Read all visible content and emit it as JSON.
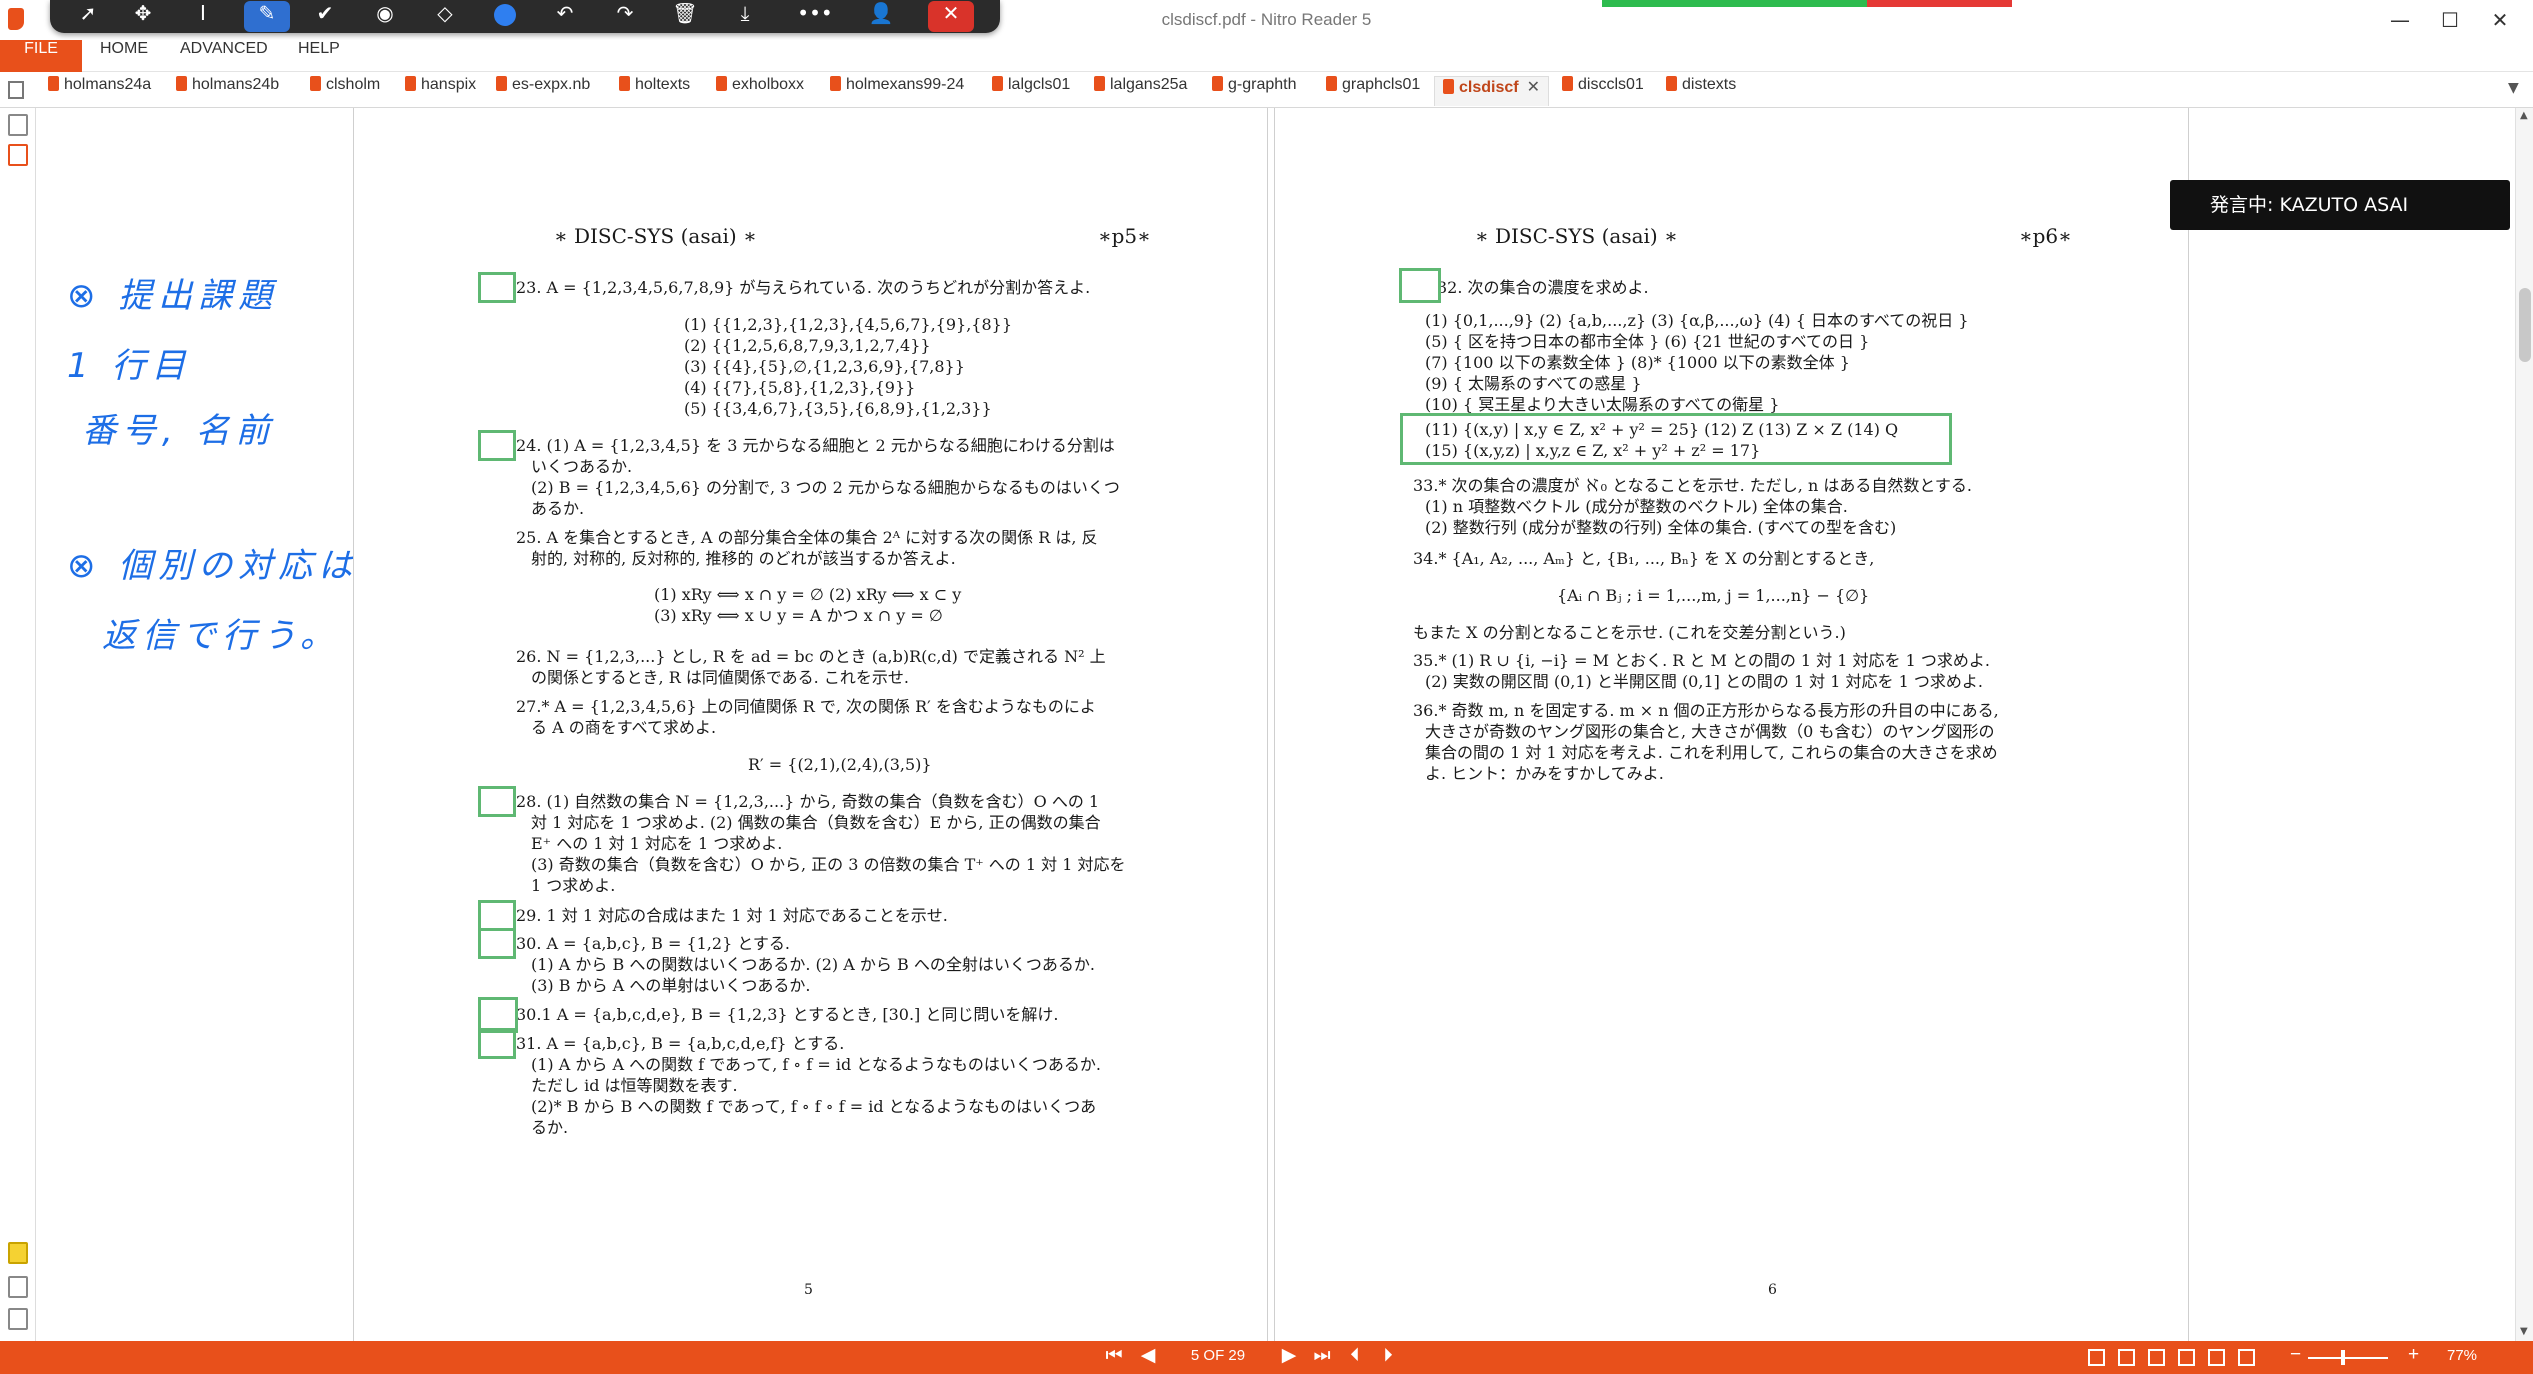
{
  "window": {
    "title": "clsdiscf.pdf - Nitro Reader 5",
    "minimize": "—",
    "maximize": "☐",
    "close": "✕"
  },
  "colors": {
    "accent": "#e8501b",
    "ink": "#1d6ee6",
    "box": "#5fb873",
    "share_green": "#2dbb4e",
    "share_red": "#e53935"
  },
  "annot_toolbar": {
    "icons": [
      "select-icon",
      "move-icon",
      "text-cursor-icon",
      "pen-icon",
      "check-icon",
      "highlighter-icon",
      "eraser-icon",
      "color-dot-icon",
      "undo-icon",
      "redo-icon",
      "trash-icon",
      "download-icon",
      "more-icon",
      "share-user-icon",
      "close-icon"
    ]
  },
  "ribbon": {
    "file": "FILE",
    "home": "HOME",
    "advanced": "ADVANCED",
    "help": "HELP"
  },
  "tabs": [
    "holmans24a",
    "holmans24b",
    "clsholm",
    "hanspix",
    "es-expx.nb",
    "holtexts",
    "exholboxx",
    "holmexans99-24",
    "lalgcls01",
    "lalgans25a",
    "g-graphth",
    "graphcls01",
    "clsdiscf",
    "disccls01",
    "distexts"
  ],
  "active_tab": "clsdiscf",
  "tab_close": "✕",
  "speaking": "発言中: KAZUTO ASAI",
  "ink_notes": {
    "line1": "⊗ 提出課題",
    "line2": "1 行目",
    "line3": "番号, 名前",
    "line4": "⊗ 個別の対応は",
    "line5": "返信で行う。"
  },
  "page5": {
    "header_left": "∗ DISC-SYS (asai) ∗",
    "header_right": "∗p5∗",
    "lines": [
      "23. A = {1,2,3,4,5,6,7,8,9} が与えられている. 次のうちどれが分割か答えよ.",
      "(1) {{1,2,3},{1,2,3},{4,5,6,7},{9},{8}}",
      "(2) {{1,2,5,6,8,7,9,3,1,2,7,4}}",
      "(3) {{4},{5},∅,{1,2,3,6,9},{7,8}}",
      "(4) {{7},{5,8},{1,2,3},{9}}",
      "(5) {{3,4,6,7},{3,5},{6,8,9},{1,2,3}}",
      "24. (1) A = {1,2,3,4,5} を 3 元からなる細胞と 2 元からなる細胞にわける分割は",
      "いくつあるか.",
      "(2) B = {1,2,3,4,5,6} の分割で, 3 つの 2 元からなる細胞からなるものはいくつ",
      "あるか.",
      "25. A を集合とするとき, A の部分集合全体の集合 2ᴬ に対する次の関係 R は, 反",
      "射的, 対称的, 反対称的, 推移的 のどれが該当するか答えよ.",
      "(1) xRy ⟺ x ∩ y = ∅      (2) xRy ⟺ x ⊂ y",
      "(3) xRy ⟺ x ∪ y = A かつ x ∩ y = ∅",
      "26. N = {1,2,3,...} とし, R を ad = bc のとき (a,b)R(c,d) で定義される N² 上",
      "の関係とするとき, R は同値関係である. これを示せ.",
      "27.* A = {1,2,3,4,5,6} 上の同値関係 R で, 次の関係 R′ を含むようなものによ",
      "る A の商をすべて求めよ.",
      "R′ = {(2,1),(2,4),(3,5)}",
      "28. (1) 自然数の集合 N = {1,2,3,...} から, 奇数の集合（負数を含む）O への 1",
      "対 1 対応を 1 つ求めよ. (2) 偶数の集合（負数を含む）E から, 正の偶数の集合",
      "E⁺ への 1 対 1 対応を 1 つ求めよ.",
      "(3) 奇数の集合（負数を含む）O から, 正の 3 の倍数の集合 T⁺ への 1 対 1 対応を",
      "1 つ求めよ.",
      "29. 1 対 1 対応の合成はまた 1 対 1 対応であることを示せ.",
      "30. A = {a,b,c}, B = {1,2} とする.",
      "(1) A から B への関数はいくつあるか. (2) A から B への全射はいくつあるか.",
      "(3) B から A への単射はいくつあるか.",
      "30.1 A = {a,b,c,d,e}, B = {1,2,3} とするとき, [30.] と同じ問いを解け.",
      "31. A = {a,b,c}, B = {a,b,c,d,e,f} とする.",
      "(1) A から A への関数 f であって, f ∘ f = id となるようなものはいくつあるか.",
      "ただし id は恒等関数を表す.",
      "(2)* B から B への関数 f であって, f ∘ f ∘ f = id となるようなものはいくつあ",
      "るか."
    ],
    "footer": "5"
  },
  "page6": {
    "header_left": "∗ DISC-SYS (asai) ∗",
    "header_right": "∗p6∗",
    "lines": [
      "32. 次の集合の濃度を求めよ.",
      "(1) {0,1,...,9} (2) {a,b,...,z} (3) {α,β,...,ω} (4) { 日本のすべての祝日 }",
      "(5) { 区を持つ日本の都市全体 }      (6) {21 世紀のすべての日 }",
      "(7) {100 以下の素数全体 }      (8)* {1000 以下の素数全体 }",
      "(9) { 太陽系のすべての惑星 }",
      "(10) { 冥王星より大きい太陽系のすべての衛星 }",
      "(11) {(x,y) | x,y ∈ Z, x² + y² = 25}   (12) Z   (13) Z × Z   (14) Q",
      "(15) {(x,y,z) | x,y,z ∈ Z, x² + y² + z² = 17}",
      "33.* 次の集合の濃度が ℵ₀ となることを示せ. ただし, n はある自然数とする.",
      "(1) n 項整数ベクトル (成分が整数のベクトル) 全体の集合.",
      "(2) 整数行列 (成分が整数の行列) 全体の集合. (すべての型を含む)",
      "34.* {A₁, A₂, ..., Aₘ} と, {B₁, ..., Bₙ} を X の分割とするとき,",
      "{Aᵢ ∩ Bⱼ ; i = 1,...,m, j = 1,...,n} − {∅}",
      "もまた X の分割となることを示せ. (これを交差分割という.)",
      "35.* (1) R ∪ {i, −i} = M とおく. R と M との間の 1 対 1 対応を 1 つ求めよ.",
      "(2) 実数の開区間 (0,1) と半開区間 (0,1] との間の 1 対 1 対応を 1 つ求めよ.",
      "36.* 奇数 m, n を固定する. m × n 個の正方形からなる長方形の升目の中にある,",
      "大きさが奇数のヤング図形の集合と, 大きさが偶数（0 も含む）のヤング図形の",
      "集合の間の 1 対 1 対応を考えよ. これを利用して, これらの集合の大きさを求め",
      "よ. ヒント：かみをすかしてみよ."
    ],
    "footer": "6"
  },
  "status": {
    "first": "⏮",
    "prev": "◀",
    "page_indicator": "5 OF 29",
    "next": "▶",
    "last": "⏭",
    "back": "⏴",
    "forward": "⏵",
    "zoom_minus": "−",
    "zoom_plus": "+",
    "zoom": "77%"
  }
}
